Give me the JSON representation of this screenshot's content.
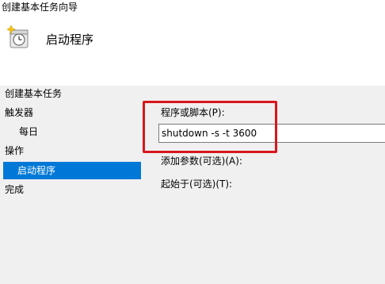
{
  "window": {
    "title": "创建基本任务向导",
    "heading": "启动程序",
    "icon": "task-clock-icon"
  },
  "steps": {
    "create_basic_task": "创建基本任务",
    "trigger": "触发器",
    "daily": "每日",
    "action": "操作",
    "start_program": "启动程序",
    "finish": "完成"
  },
  "form": {
    "program_label": "程序或脚本(P):",
    "program_value": "shutdown -s -t 3600",
    "args_label": "添加参数(可选)(A):",
    "start_in_label": "起始于(可选)(T):"
  },
  "colors": {
    "selection": "#0078d7",
    "highlight_box": "#d8161c",
    "panel_bg": "#f0f0f0"
  }
}
